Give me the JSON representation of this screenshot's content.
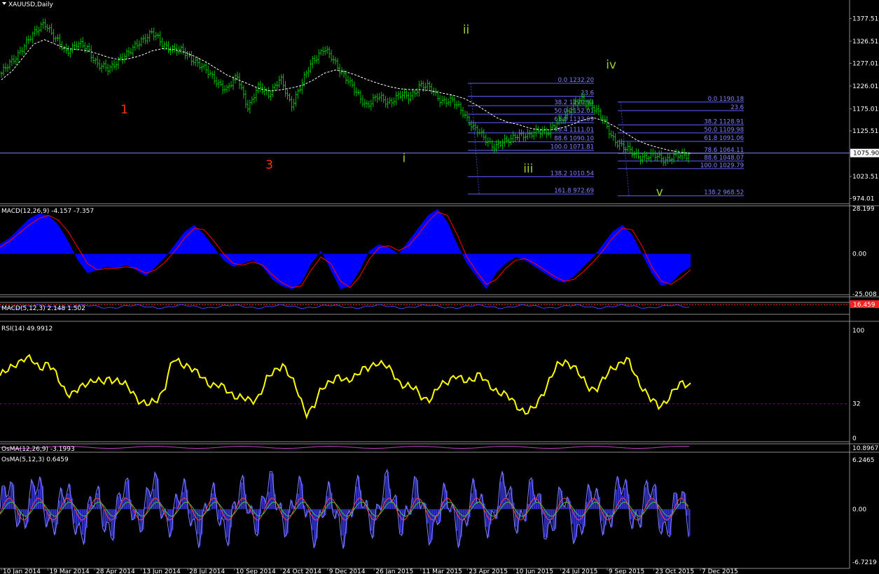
{
  "window": {
    "title": "XAUUSD,Daily"
  },
  "chart_data": [
    {
      "type": "line",
      "panel": "price",
      "title": "XAUUSD,Daily",
      "price_axis_labels": [
        "1377.51",
        "1326.51",
        "1277.01",
        "1226.01",
        "1175.01",
        "1125.51",
        "1075.90",
        "1023.51",
        "974.01"
      ],
      "current_price": 1075.9,
      "ylim": [
        967,
        1397
      ],
      "series": [
        {
          "name": "",
          "color": "#00c000",
          "style": "ohlc-bars",
          "values": [
            1255,
            1280,
            1315,
            1340,
            1372,
            1330,
            1305,
            1320,
            1310,
            1275,
            1260,
            1290,
            1300,
            1330,
            1345,
            1320,
            1310,
            1300,
            1285,
            1260,
            1240,
            1215,
            1250,
            1175,
            1225,
            1210,
            1240,
            1185,
            1230,
            1285,
            1310,
            1280,
            1250,
            1210,
            1185,
            1200,
            1190,
            1205,
            1200,
            1230,
            1218,
            1195,
            1190,
            1170,
            1130,
            1110,
            1090,
            1100,
            1120,
            1110,
            1130,
            1120,
            1150,
            1175,
            1195,
            1185,
            1150,
            1110,
            1085,
            1075,
            1065,
            1070,
            1062,
            1068,
            1075
          ]
        },
        {
          "name": "",
          "color": "#ffffff",
          "style": "dashed",
          "values": [
            1240,
            1260,
            1290,
            1320,
            1330,
            1320,
            1310,
            1308,
            1305,
            1298,
            1290,
            1285,
            1288,
            1295,
            1305,
            1310,
            1308,
            1302,
            1292,
            1280,
            1265,
            1250,
            1240,
            1230,
            1220,
            1215,
            1218,
            1222,
            1228,
            1240,
            1255,
            1262,
            1258,
            1250,
            1240,
            1232,
            1225,
            1220,
            1218,
            1218,
            1215,
            1210,
            1205,
            1198,
            1185,
            1170,
            1155,
            1145,
            1140,
            1132,
            1128,
            1128,
            1132,
            1140,
            1150,
            1155,
            1148,
            1135,
            1120,
            1105,
            1095,
            1088,
            1082,
            1078,
            1075
          ]
        }
      ],
      "wave_labels": [
        {
          "text": "1",
          "color": "#ff3300",
          "price": 1165,
          "at": 0.18
        },
        {
          "text": "3",
          "color": "#ff3300",
          "price": 1041,
          "at": 0.39
        },
        {
          "text": "i",
          "color": "#9acd32",
          "price": 1056,
          "at": 0.585
        },
        {
          "text": "ii",
          "color": "#9acd32",
          "price": 1344,
          "at": 0.675
        },
        {
          "text": "iii",
          "color": "#9acd32",
          "price": 1032,
          "at": 0.765
        },
        {
          "text": "iv",
          "color": "#9acd32",
          "price": 1265,
          "at": 0.885
        },
        {
          "text": "v",
          "color": "#9acd32",
          "price": 980,
          "at": 0.955
        }
      ],
      "fibo_sets": [
        {
          "levels": [
            {
              "label": "0.0 1232.20",
              "price": 1232.2
            },
            {
              "label": "23.6",
              "price": 1203
            },
            {
              "label": "38.2 1170.93",
              "price": 1182
            },
            {
              "label": "50.0 1152.01",
              "price": 1163
            },
            {
              "label": "61.8 1133.09",
              "price": 1144
            },
            {
              "label": "76.4 1111.01",
              "price": 1121
            },
            {
              "label": "88.6 1090.10",
              "price": 1101
            },
            {
              "label": "100.0 1071.81",
              "price": 1082
            },
            {
              "label": "138.2 1010.54",
              "price": 1023
            },
            {
              "label": "161.8 972.69",
              "price": 984
            }
          ]
        },
        {
          "levels": [
            {
              "label": "0.0 1190.18",
              "price": 1190.18
            },
            {
              "label": "23.6",
              "price": 1171
            },
            {
              "label": "38.2 1128.91",
              "price": 1139
            },
            {
              "label": "50.0 1109.98",
              "price": 1121
            },
            {
              "label": "61.8 1091.06",
              "price": 1102
            },
            {
              "label": "78.6 1064.11",
              "price": 1075
            },
            {
              "label": "88.6 1048.07",
              "price": 1058
            },
            {
              "label": "100.0 1029.79",
              "price": 1041
            },
            {
              "label": "138.2 968.52",
              "price": 980
            }
          ]
        }
      ]
    },
    {
      "type": "area",
      "panel": "macd",
      "title": "MACD(12,26,9) -4.157 -7.357",
      "axis_labels": [
        "28.199",
        "0.00",
        "-25.008"
      ],
      "ylim": [
        -25.008,
        28.199
      ],
      "series": [
        {
          "name": "",
          "color": "#0000ff",
          "style": "histogram-area",
          "values": [
            6,
            10,
            16,
            22,
            25,
            24,
            18,
            8,
            -4,
            -12,
            -10,
            -8,
            -9,
            -7,
            -10,
            -14,
            -8,
            -2,
            6,
            14,
            18,
            12,
            4,
            -4,
            -8,
            -6,
            -4,
            -8,
            -16,
            -20,
            -22,
            -18,
            -6,
            2,
            -10,
            -22,
            -20,
            -10,
            2,
            6,
            4,
            0,
            8,
            16,
            24,
            28,
            20,
            6,
            -6,
            -14,
            -22,
            -12,
            -6,
            -2,
            -4,
            -8,
            -12,
            -16,
            -18,
            -14,
            -8,
            -2,
            6,
            14,
            18,
            12,
            0,
            -12,
            -20,
            -18,
            -12,
            -8
          ]
        },
        {
          "name": "",
          "color": "#ff0000",
          "style": "line",
          "values": [
            4,
            8,
            13,
            18,
            22,
            24,
            21,
            14,
            4,
            -6,
            -10,
            -9,
            -9,
            -8,
            -9,
            -12,
            -10,
            -5,
            2,
            10,
            16,
            15,
            8,
            0,
            -6,
            -7,
            -5,
            -7,
            -13,
            -18,
            -21,
            -20,
            -10,
            -2,
            -6,
            -17,
            -21,
            -14,
            -3,
            4,
            5,
            2,
            5,
            12,
            20,
            26,
            24,
            12,
            -2,
            -11,
            -19,
            -16,
            -9,
            -4,
            -3,
            -6,
            -10,
            -14,
            -17,
            -16,
            -11,
            -5,
            2,
            10,
            16,
            15,
            5,
            -8,
            -17,
            -19,
            -15,
            -10
          ]
        }
      ]
    },
    {
      "type": "line",
      "panel": "macd-fast",
      "title": "MACD(5,12,3) 2.148 1.502",
      "axis_labels": [
        "16.459"
      ],
      "marker_value": 16.459
    },
    {
      "type": "line",
      "panel": "rsi",
      "title": "RSI(14) 49.9912",
      "axis_labels": [
        "100",
        "32",
        "0"
      ],
      "ylim": [
        0,
        100
      ],
      "level": 32,
      "series": [
        {
          "name": "",
          "color": "#ffff00",
          "style": "line",
          "values": [
            58,
            62,
            70,
            74,
            72,
            66,
            70,
            60,
            48,
            40,
            44,
            52,
            55,
            50,
            56,
            54,
            48,
            42,
            34,
            30,
            36,
            48,
            72,
            70,
            68,
            60,
            55,
            50,
            48,
            44,
            40,
            36,
            34,
            40,
            54,
            62,
            70,
            56,
            42,
            24,
            28,
            46,
            54,
            56,
            52,
            58,
            62,
            64,
            72,
            68,
            60,
            52,
            48,
            44,
            38,
            36,
            48,
            54,
            58,
            52,
            55,
            60,
            50,
            46,
            42,
            36,
            30,
            24,
            26,
            40,
            54,
            66,
            72,
            68,
            56,
            48,
            46,
            54,
            66,
            70,
            72,
            58,
            46,
            34,
            30,
            36,
            44,
            52,
            50
          ]
        }
      ]
    },
    {
      "type": "line",
      "panel": "osma-slow",
      "title": "OsMA(12,26,9) -3.1993",
      "axis_labels": [
        "10.8967"
      ]
    },
    {
      "type": "bar",
      "panel": "osma",
      "title": "OsMA(5,12,3) 0.6459",
      "axis_labels": [
        "6.2465",
        "0.00",
        "-6.7219"
      ],
      "ylim": [
        -6.7219,
        6.2465
      ]
    }
  ],
  "time_axis": {
    "labels": [
      "10 Jan 2014",
      "19 Mar 2014",
      "28 Apr 2014",
      "13 Jun 2014",
      "28 Jul 2014",
      "10 Sep 2014",
      "24 Oct 2014",
      "9 Dec 2014",
      "26 Jan 2015",
      "11 Mar 2015",
      "23 Apr 2015",
      "10 Jun 2015",
      "24 Jul 2015",
      "9 Sep 2015",
      "23 Oct 2015",
      "7 Dec 2015"
    ]
  },
  "colors": {
    "background": "#000000",
    "price_bars": "#00c000",
    "moving_average": "#ffffff",
    "fibo": "#8080ff",
    "macd_hist": "#0000ff",
    "macd_signal": "#ff0000",
    "rsi": "#ffff00",
    "grid_dotted": "#800080"
  }
}
